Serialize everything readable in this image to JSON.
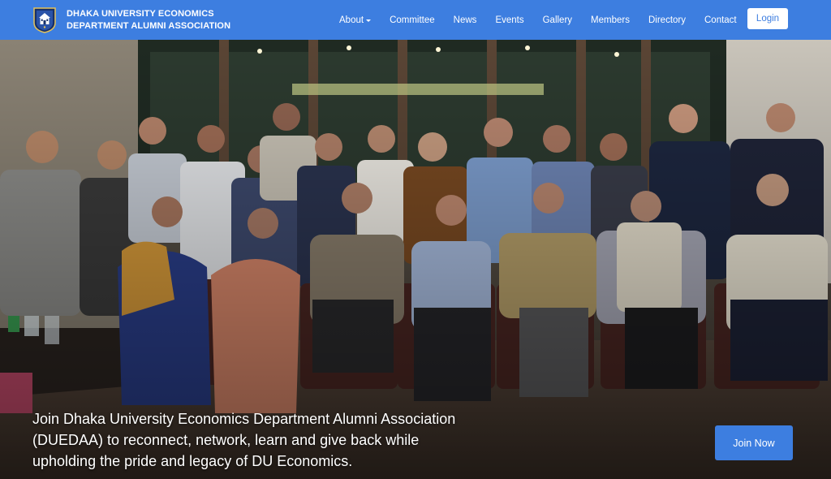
{
  "brand": {
    "title_line1": "DHAKA UNIVERSITY ECONOMICS",
    "title_line2": "DEPARTMENT ALUMNI ASSOCIATION",
    "logo_icon": "university-crest-icon"
  },
  "nav": {
    "items": [
      {
        "label": "About",
        "has_dropdown": true
      },
      {
        "label": "Committee"
      },
      {
        "label": "News"
      },
      {
        "label": "Events"
      },
      {
        "label": "Gallery"
      },
      {
        "label": "Members"
      },
      {
        "label": "Directory"
      },
      {
        "label": "Contact"
      }
    ],
    "login_label": "Login"
  },
  "hero": {
    "tagline": "Join Dhaka University Economics Department Alumni Association (DUEDAA) to reconnect, network, learn and give back while upholding the pride and legacy of DU Economics.",
    "join_label": "Join Now"
  },
  "colors": {
    "primary": "#3d7ee0",
    "white": "#ffffff"
  }
}
